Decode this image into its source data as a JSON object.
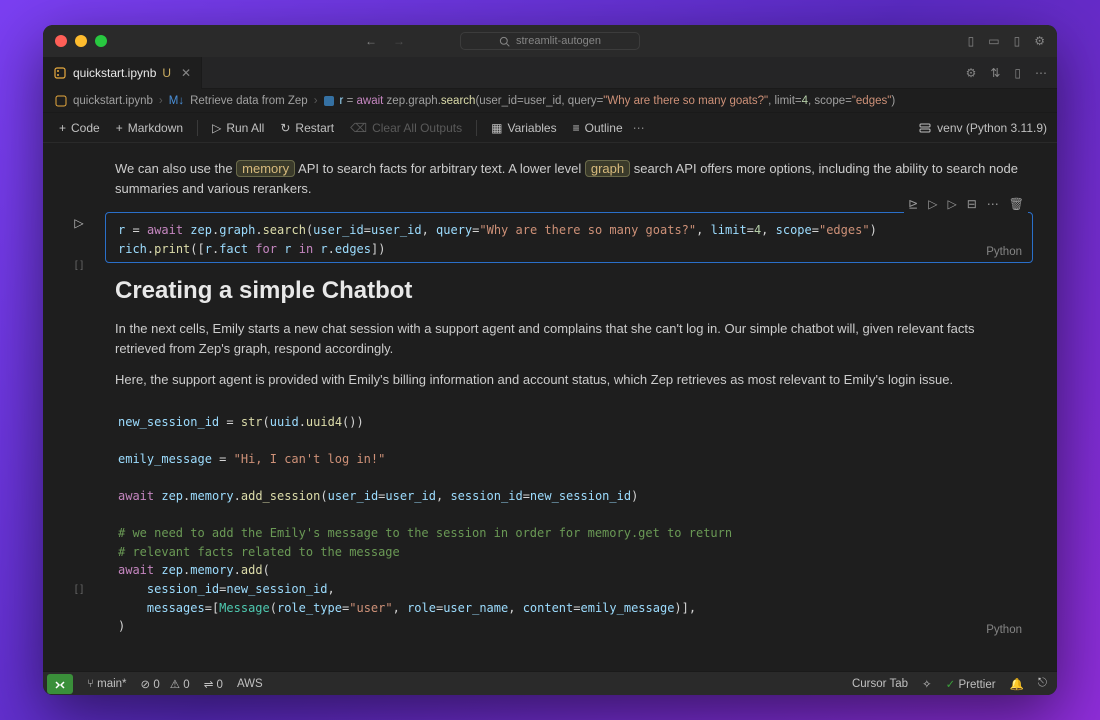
{
  "titlebar": {
    "search_text": "streamlit-autogen"
  },
  "tab": {
    "filename": "quickstart.ipynb",
    "modified": "U"
  },
  "breadcrumb": {
    "file": "quickstart.ipynb",
    "section": "Retrieve data from Zep",
    "code": "r = await zep.graph.search(user_id=user_id, query=\"Why are there so many goats?\", limit=4, scope=\"edges\")"
  },
  "nb_toolbar": {
    "code": "Code",
    "markdown": "Markdown",
    "run_all": "Run All",
    "restart": "Restart",
    "clear": "Clear All Outputs",
    "variables": "Variables",
    "outline": "Outline",
    "kernel": "venv (Python 3.11.9)"
  },
  "markdown1": {
    "pre": "We can also use the ",
    "pill1": "memory",
    "mid": " API to search facts for arbitrary text. A lower level ",
    "pill2": "graph",
    "post": " search API offers more options, including the ability to search node summaries and various rerankers."
  },
  "cell1": {
    "lang": "Python",
    "exec": "[ ]"
  },
  "section_heading": "Creating a simple Chatbot",
  "para1": "In the next cells, Emily starts a new chat session with a support agent and complains that she can't log in. Our simple chatbot will, given relevant facts retrieved from Zep's graph, respond accordingly.",
  "para2": "Here, the support agent is provided with Emily's billing information and account status, which Zep retrieves as most relevant to Emily's login issue.",
  "cell2": {
    "lang": "Python",
    "exec": "[ ]"
  },
  "code1": {
    "query": "\"Why are there so many goats?\"",
    "scope": "\"edges\"",
    "limit": "4"
  },
  "code2": {
    "msg": "\"Hi, I can't log in!\"",
    "role_type": "\"user\"",
    "comment1": "# we need to add the Emily's message to the session in order for memory.get to return",
    "comment2": "# relevant facts related to the message"
  },
  "status": {
    "branch": "main*",
    "errors": "0",
    "warnings": "0",
    "ports": "0",
    "aws": "AWS",
    "cursor_tab": "Cursor Tab",
    "prettier": "Prettier"
  }
}
